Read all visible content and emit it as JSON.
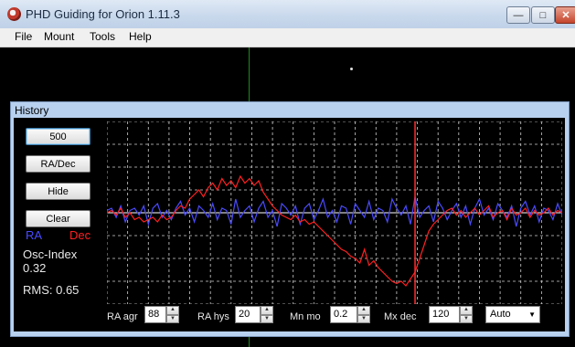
{
  "window": {
    "title": "PHD Guiding for Orion 1.11.3"
  },
  "menu": [
    "File",
    "Mount",
    "Tools",
    "Help"
  ],
  "history": {
    "title": "History",
    "buttons": {
      "scale": "500",
      "mode": "RA/Dec",
      "hide": "Hide",
      "clear": "Clear"
    },
    "legend": {
      "ra": "RA",
      "dec": "Dec"
    },
    "osc_label": "Osc-Index",
    "osc_value": "0.32",
    "rms": "RMS: 0.65",
    "controls": {
      "ra_agr_label": "RA agr",
      "ra_agr": "88",
      "ra_hys_label": "RA hys",
      "ra_hys": "20",
      "mn_mo_label": "Mn mo",
      "mn_mo": "0.2",
      "mx_dec_label": "Mx dec",
      "mx_dec": "120",
      "auto": "Auto"
    }
  },
  "colors": {
    "ra": "#4a4aff",
    "dec": "#ff2020",
    "grid": "#d0d0d0",
    "cursor": "#ff3030"
  },
  "chart_data": {
    "type": "line",
    "grid": true,
    "n_points": 100,
    "series": [
      {
        "name": "RA",
        "values": [
          0.1,
          0.2,
          -0.2,
          0.3,
          -0.4,
          0.1,
          0.2,
          -0.1,
          0.3,
          -0.5,
          0.2,
          0.4,
          -0.2,
          0.1,
          -0.3,
          0.2,
          0.5,
          -0.1,
          0.2,
          -0.4,
          0.3,
          0.1,
          -0.2,
          0.4,
          -0.3,
          0.2,
          0.1,
          -0.5,
          0.6,
          -0.2,
          0.1,
          0.3,
          -0.4,
          0.2,
          0.5,
          -0.2,
          0.1,
          -0.6,
          0.4,
          0.2,
          -0.1,
          0.3,
          -0.5,
          0.2,
          0.4,
          -0.3,
          0.1,
          0.6,
          -0.2,
          0.1,
          -0.4,
          0.3,
          0.2,
          -0.5,
          0.4,
          0.1,
          -0.2,
          0.5,
          -0.3,
          0.2,
          0.1,
          -0.4,
          0.6,
          0.2,
          -0.1,
          0.3,
          -0.5,
          0.7,
          -0.2,
          0.1,
          0.3,
          -0.4,
          0.5,
          0.2,
          -0.3,
          0.1,
          0.4,
          -0.2,
          0.3,
          -0.5,
          0.2,
          0.6,
          -0.1,
          0.2,
          -0.3,
          0.4,
          0.1,
          -0.2,
          0.3,
          -0.6,
          0.2,
          0.5,
          -0.1,
          0.3,
          -0.4,
          0.2,
          0.1,
          -0.3,
          0.4,
          -0.1
        ]
      },
      {
        "name": "Dec",
        "values": [
          0.0,
          0.1,
          -0.1,
          0.2,
          -0.2,
          0.0,
          -0.3,
          -0.2,
          -0.4,
          -0.3,
          -0.2,
          -0.4,
          -0.1,
          -0.3,
          -0.2,
          0.1,
          0.3,
          0.2,
          0.6,
          0.8,
          1.0,
          0.7,
          1.1,
          1.3,
          1.0,
          1.5,
          1.2,
          1.4,
          1.1,
          1.6,
          1.3,
          1.5,
          1.2,
          1.4,
          0.9,
          0.6,
          0.3,
          0.1,
          -0.1,
          -0.2,
          -0.3,
          -0.1,
          -0.4,
          -0.3,
          -0.5,
          -0.4,
          -0.6,
          -0.8,
          -1.0,
          -1.2,
          -1.4,
          -1.6,
          -1.7,
          -1.9,
          -2.0,
          -2.2,
          -1.6,
          -2.3,
          -2.1,
          -2.4,
          -2.6,
          -2.8,
          -3.0,
          -3.1,
          -3.0,
          -3.2,
          -2.9,
          -2.6,
          -2.0,
          -1.4,
          -0.8,
          -0.5,
          -0.3,
          -0.1,
          0.1,
          0.2,
          -0.1,
          0.1,
          -0.2,
          0.0,
          0.2,
          -0.1,
          0.1,
          0.3,
          -0.2,
          0.0,
          0.1,
          -0.3,
          0.2,
          -0.1,
          0.0,
          0.2,
          -0.2,
          0.1,
          -0.1,
          0.0,
          0.2,
          -0.1,
          0.1,
          0.0
        ]
      }
    ],
    "ylim": [
      -4,
      4
    ],
    "cursor_index": 67
  }
}
